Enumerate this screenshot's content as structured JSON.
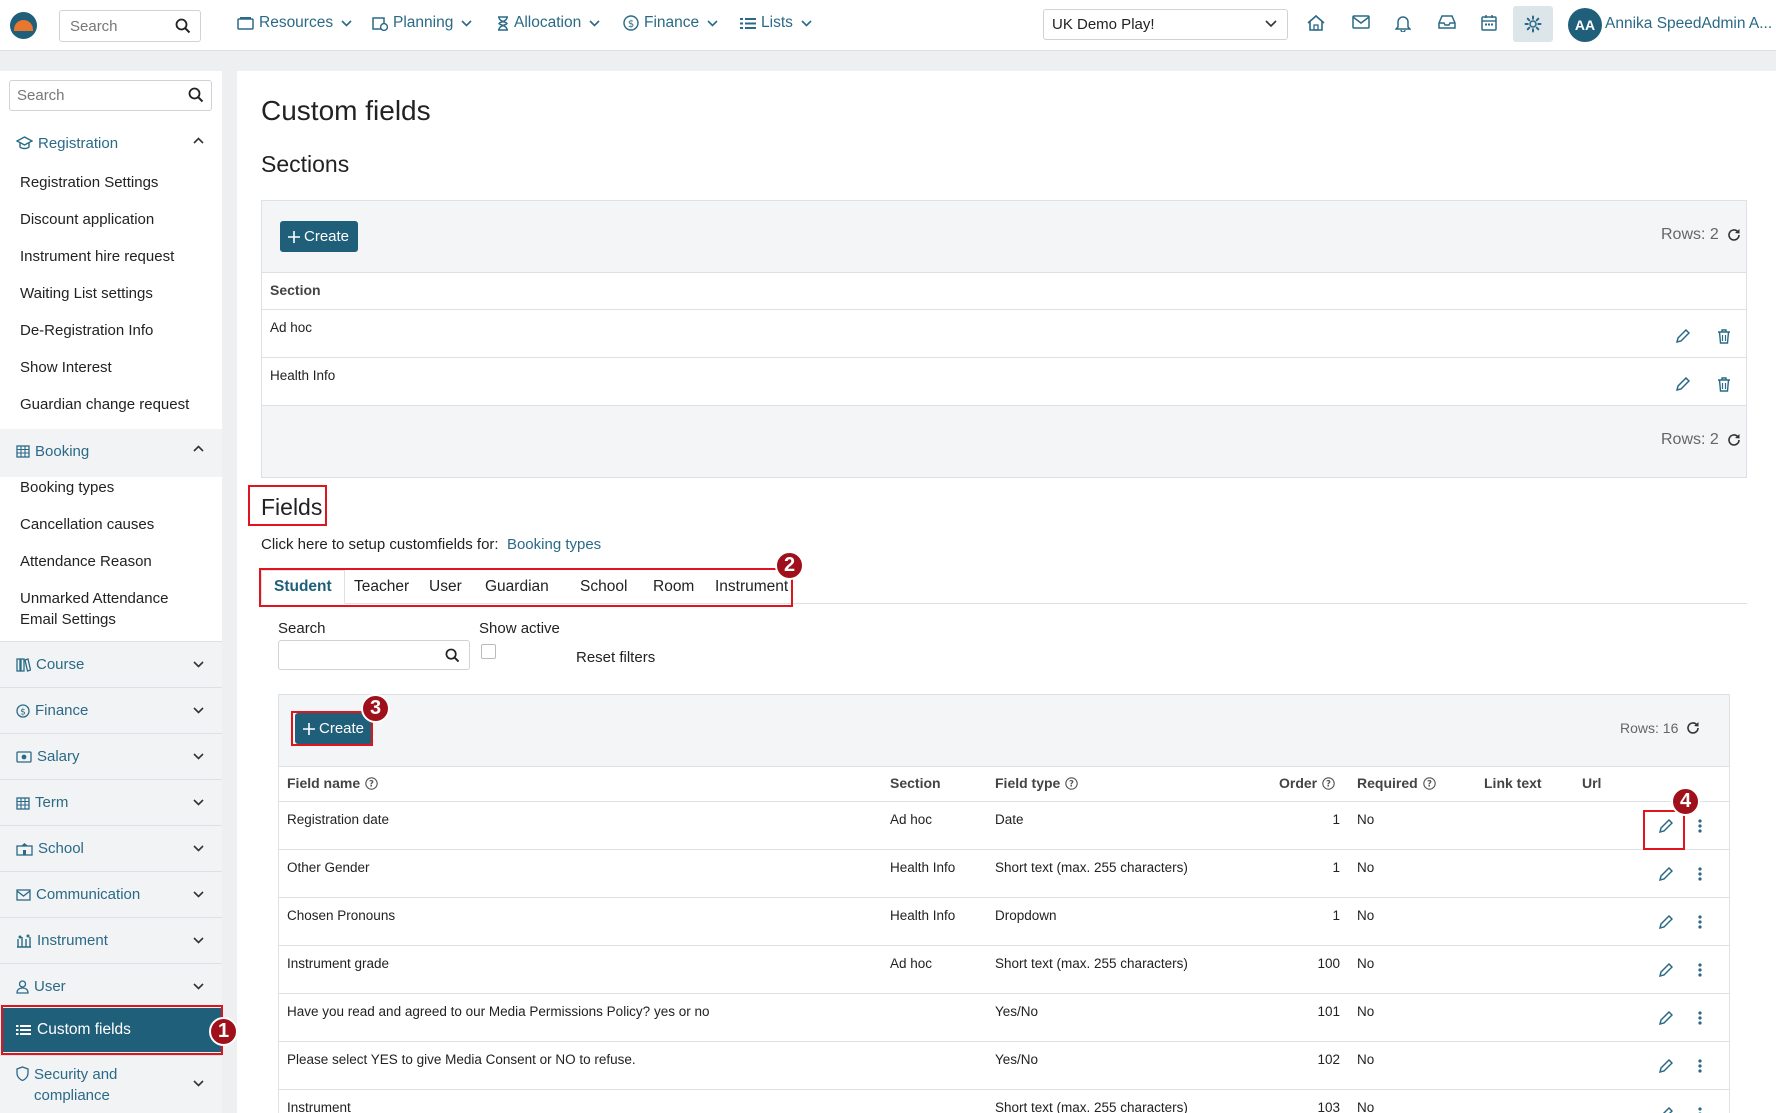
{
  "topbar": {
    "search_placeholder": "Search",
    "nav": [
      {
        "label": "Resources",
        "icon": "resources-icon"
      },
      {
        "label": "Planning",
        "icon": "planning-icon"
      },
      {
        "label": "Allocation",
        "icon": "hourglass-icon"
      },
      {
        "label": "Finance",
        "icon": "dollar-icon"
      },
      {
        "label": "Lists",
        "icon": "list-icon"
      }
    ],
    "organisation": "UK Demo Play!",
    "user_initials": "AA",
    "user_name": "Annika SpeedAdmin A..."
  },
  "sidebar": {
    "search_placeholder": "Search",
    "sections": {
      "registration": {
        "label": "Registration",
        "items": [
          "Registration Settings",
          "Discount application",
          "Instrument hire request",
          "Waiting List settings",
          "De-Registration Info",
          "Show Interest",
          "Guardian change request"
        ]
      },
      "booking": {
        "label": "Booking",
        "items": [
          "Booking types",
          "Cancellation causes",
          "Attendance Reason",
          "Unmarked Attendance Email Settings"
        ]
      },
      "course": "Course",
      "finance": "Finance",
      "salary": "Salary",
      "term": "Term",
      "school": "School",
      "communication": "Communication",
      "instrument": "Instrument",
      "user": "User",
      "custom_fields": "Custom fields",
      "security": "Security and compliance"
    }
  },
  "main": {
    "title": "Custom fields",
    "sections": {
      "heading": "Sections",
      "create_label": "Create",
      "rows_label": "Rows: 2",
      "column": "Section",
      "rows": [
        "Ad hoc",
        "Health Info"
      ]
    },
    "fields": {
      "heading": "Fields",
      "setup_text": "Click here to setup customfields for:",
      "setup_link": "Booking types",
      "tabs": [
        "Student",
        "Teacher",
        "User",
        "Guardian",
        "School",
        "Room",
        "Instrument"
      ],
      "active_tab": "Student",
      "search_label": "Search",
      "show_active_label": "Show active",
      "reset_filters": "Reset filters",
      "create_label": "Create",
      "rows_label": "Rows: 16",
      "columns": {
        "field_name": "Field name",
        "section": "Section",
        "field_type": "Field type",
        "order": "Order",
        "required": "Required",
        "link_text": "Link text",
        "url": "Url"
      },
      "rows": [
        {
          "name": "Registration date",
          "section": "Ad hoc",
          "type": "Date",
          "order": "1",
          "required": "No"
        },
        {
          "name": "Other Gender",
          "section": "Health Info",
          "type": "Short text (max. 255 characters)",
          "order": "1",
          "required": "No"
        },
        {
          "name": "Chosen Pronouns",
          "section": "Health Info",
          "type": "Dropdown",
          "order": "1",
          "required": "No"
        },
        {
          "name": "Instrument grade",
          "section": "Ad hoc",
          "type": "Short text (max. 255 characters)",
          "order": "100",
          "required": "No"
        },
        {
          "name": "Have you read and agreed to our Media Permissions Policy? yes or no",
          "section": "",
          "type": "Yes/No",
          "order": "101",
          "required": "No"
        },
        {
          "name": "Please select YES to give Media Consent or NO to refuse.",
          "section": "",
          "type": "Yes/No",
          "order": "102",
          "required": "No"
        },
        {
          "name": "Instrument",
          "section": "",
          "type": "Short text (max. 255 characters)",
          "order": "103",
          "required": "No"
        }
      ]
    }
  },
  "annotations": [
    "1",
    "2",
    "3",
    "4"
  ],
  "colors": {
    "primary": "#1f5f7a",
    "link": "#2a6a86",
    "highlight": "#e0141c",
    "marker": "#a0101a"
  }
}
